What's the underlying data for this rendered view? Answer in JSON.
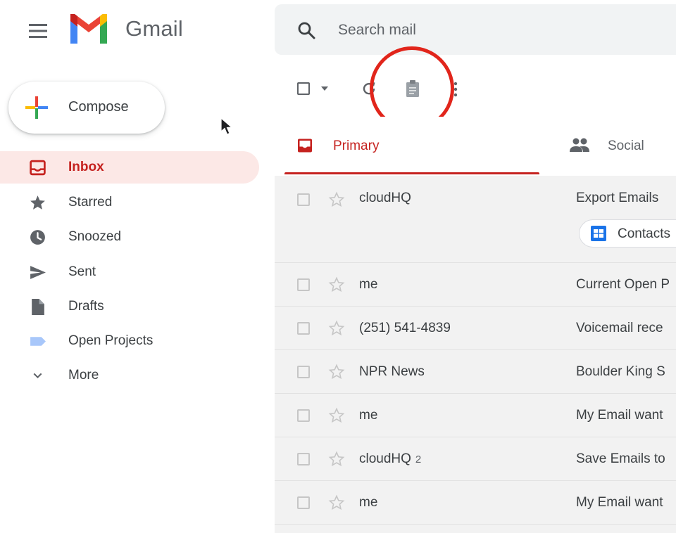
{
  "header": {
    "app_name": "Gmail",
    "search_placeholder": "Search mail"
  },
  "sidebar": {
    "compose_label": "Compose",
    "items": [
      {
        "label": "Inbox",
        "icon": "inbox-icon",
        "active": true
      },
      {
        "label": "Starred",
        "icon": "star-icon"
      },
      {
        "label": "Snoozed",
        "icon": "clock-icon"
      },
      {
        "label": "Sent",
        "icon": "send-icon"
      },
      {
        "label": "Drafts",
        "icon": "draft-icon"
      },
      {
        "label": "Open Projects",
        "icon": "label-icon"
      },
      {
        "label": "More",
        "icon": "chevron-down-icon"
      }
    ]
  },
  "toolbar": {
    "icons": [
      "checkbox-icon",
      "caret-down-icon",
      "refresh-icon",
      "clipboard-icon",
      "more-vert-icon"
    ]
  },
  "tabs": [
    {
      "label": "Primary",
      "icon": "inbox-icon",
      "active": true
    },
    {
      "label": "Social",
      "icon": "people-icon"
    }
  ],
  "emails": [
    {
      "sender": "cloudHQ",
      "count": "",
      "subject": "Export Emails",
      "attachment": "Contacts"
    },
    {
      "sender": "me",
      "count": "",
      "subject": "Current Open P"
    },
    {
      "sender": "(251) 541-4839",
      "count": "",
      "subject": "Voicemail rece"
    },
    {
      "sender": "NPR News",
      "count": "",
      "subject": "Boulder King S"
    },
    {
      "sender": "me",
      "count": "",
      "subject": "My Email want"
    },
    {
      "sender": "cloudHQ",
      "count": "2",
      "subject": "Save Emails to"
    },
    {
      "sender": "me",
      "count": "",
      "subject": "My Email want"
    }
  ],
  "colors": {
    "accent_red": "#c5221f",
    "highlight_circle": "#e1251b",
    "inbox_active_bg": "#fce8e6",
    "search_bg": "#f1f3f4"
  }
}
